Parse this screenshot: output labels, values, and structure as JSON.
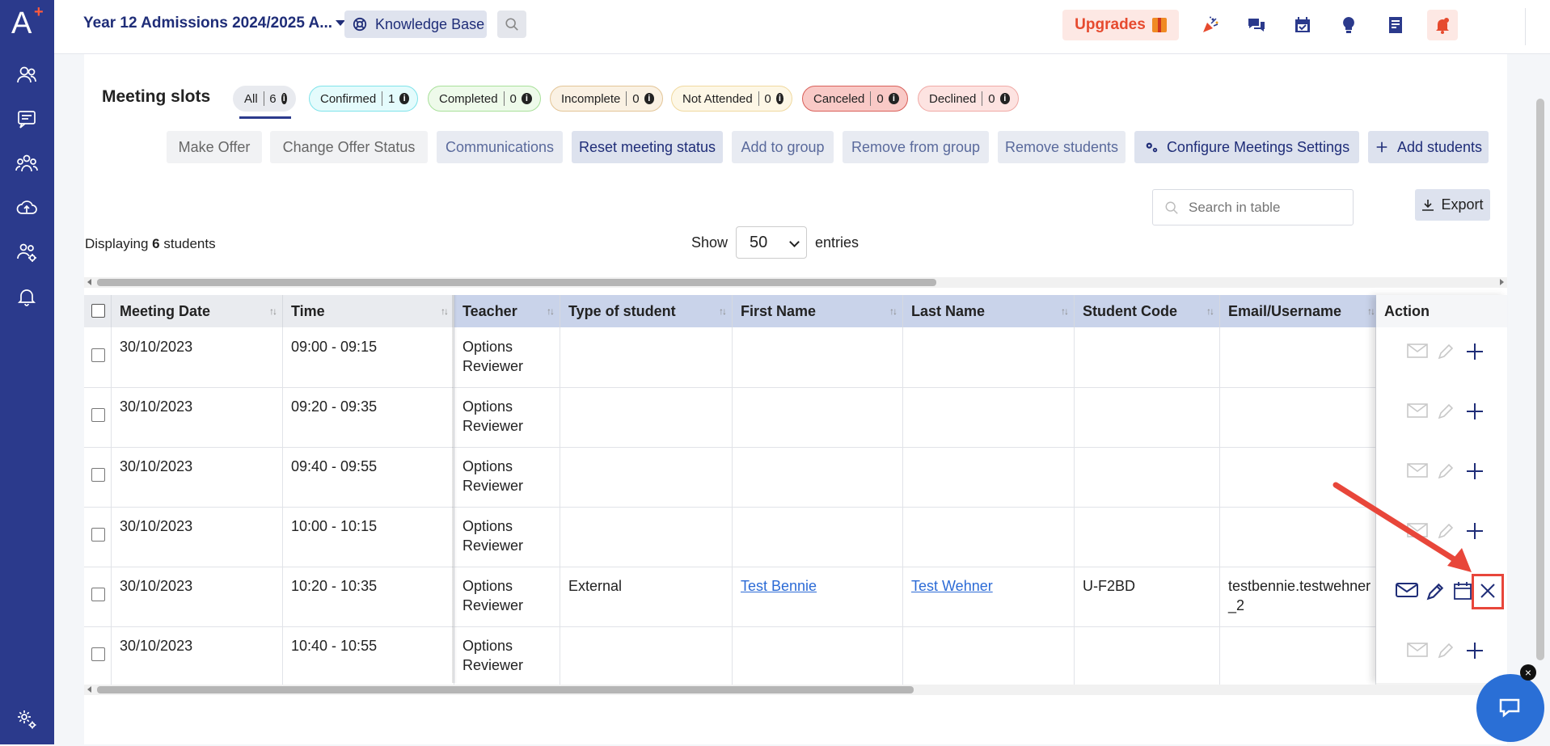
{
  "topbar": {
    "project_title": "Year 12 Admissions 2024/2025 A...",
    "knowledge_base": "Knowledge Base",
    "upgrades": "Upgrades"
  },
  "colors": {
    "brand": "#2b3a8c",
    "accent": "#e64a2e",
    "highlight": "#e8463a"
  },
  "section_title": "Meeting slots",
  "filters": [
    {
      "label": "All",
      "count": "6"
    },
    {
      "label": "Confirmed",
      "count": "1"
    },
    {
      "label": "Completed",
      "count": "0"
    },
    {
      "label": "Incomplete",
      "count": "0"
    },
    {
      "label": "Not Attended",
      "count": "0"
    },
    {
      "label": "Canceled",
      "count": "0"
    },
    {
      "label": "Declined",
      "count": "0"
    }
  ],
  "actions": {
    "make_offer": "Make Offer",
    "change_offer_status": "Change Offer Status",
    "communications": "Communications",
    "reset_meeting_status": "Reset meeting status",
    "add_to_group": "Add to group",
    "remove_from_group": "Remove from group",
    "remove_students": "Remove students",
    "configure_meetings": "Configure Meetings Settings",
    "add_students": "Add students"
  },
  "search": {
    "placeholder": "Search in table"
  },
  "export": "Export",
  "displaying": {
    "prefix": "Displaying ",
    "count": "6",
    "suffix": " students"
  },
  "entries": {
    "show": "Show",
    "value": "50",
    "label": "entries"
  },
  "table": {
    "headers": [
      "Meeting Date",
      "Time",
      "Teacher",
      "Type of student",
      "First Name",
      "Last Name",
      "Student Code",
      "Email/Username",
      "Action"
    ],
    "rows": [
      {
        "date": "30/10/2023",
        "time": "09:00 - 09:15",
        "teacher_1": "Options",
        "teacher_2": "Reviewer",
        "type": "",
        "first": "",
        "last": "",
        "code": "",
        "email": ""
      },
      {
        "date": "30/10/2023",
        "time": "09:20 - 09:35",
        "teacher_1": "Options",
        "teacher_2": "Reviewer",
        "type": "",
        "first": "",
        "last": "",
        "code": "",
        "email": ""
      },
      {
        "date": "30/10/2023",
        "time": "09:40 - 09:55",
        "teacher_1": "Options",
        "teacher_2": "Reviewer",
        "type": "",
        "first": "",
        "last": "",
        "code": "",
        "email": ""
      },
      {
        "date": "30/10/2023",
        "time": "10:00 - 10:15",
        "teacher_1": "Options",
        "teacher_2": "Reviewer",
        "type": "",
        "first": "",
        "last": "",
        "code": "",
        "email": ""
      },
      {
        "date": "30/10/2023",
        "time": "10:20 - 10:35",
        "teacher_1": "Options",
        "teacher_2": "Reviewer",
        "type": "External",
        "first": "Test Bennie",
        "last": "Test Wehner",
        "code": "U-F2BD",
        "email_1": "testbennie.testwehner",
        "email_2": "_2"
      },
      {
        "date": "30/10/2023",
        "time": "10:40 - 10:55",
        "teacher_1": "Options",
        "teacher_2": "Reviewer",
        "type": "",
        "first": "",
        "last": "",
        "code": "",
        "email": ""
      }
    ]
  }
}
